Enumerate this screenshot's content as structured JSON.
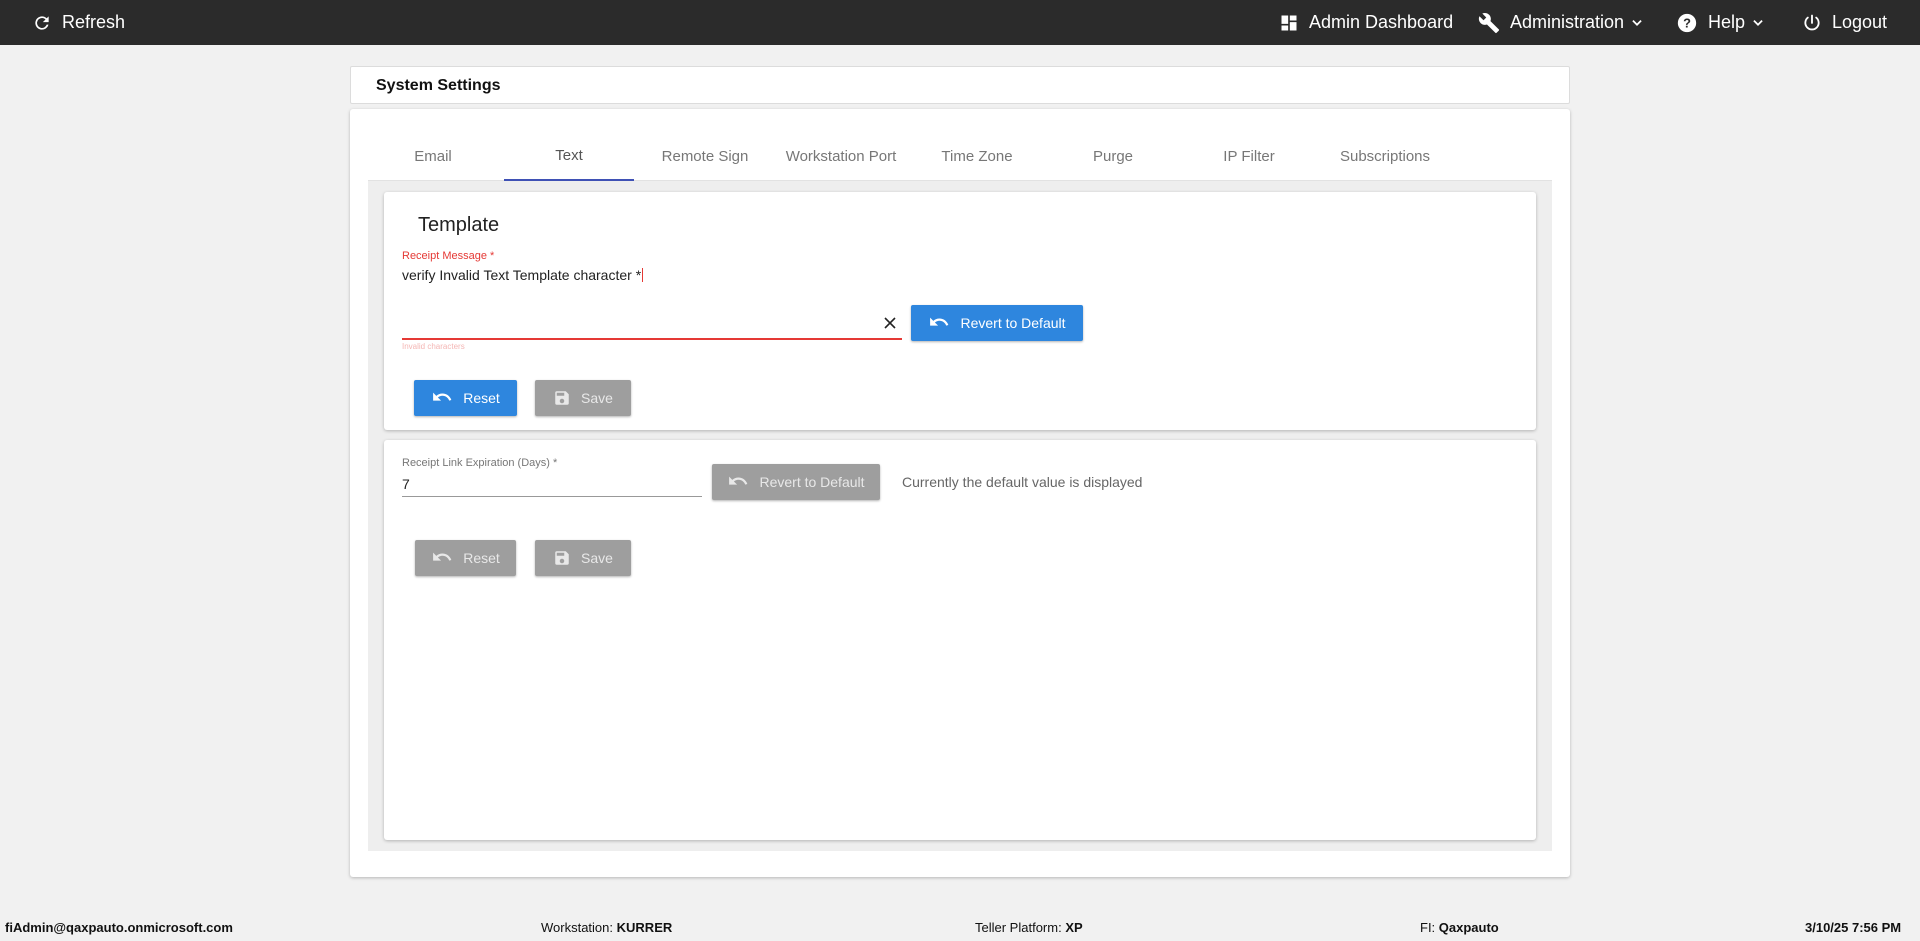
{
  "topbar": {
    "refresh_label": "Refresh",
    "admin_dashboard_label": "Admin Dashboard",
    "administration_label": "Administration",
    "help_label": "Help",
    "logout_label": "Logout"
  },
  "panel": {
    "title": "System Settings"
  },
  "tabs": [
    {
      "label": "Email"
    },
    {
      "label": "Text"
    },
    {
      "label": "Remote Sign"
    },
    {
      "label": "Workstation Port"
    },
    {
      "label": "Time Zone"
    },
    {
      "label": "Purge"
    },
    {
      "label": "IP Filter"
    },
    {
      "label": "Subscriptions"
    }
  ],
  "active_tab": "Text",
  "template_card": {
    "title": "Template",
    "receipt_message": {
      "label": "Receipt Message *",
      "value": "verify Invalid Text Template character *",
      "hint": "Invalid characters"
    },
    "revert_label": "Revert to Default",
    "reset_label": "Reset",
    "save_label": "Save"
  },
  "expiration_card": {
    "field": {
      "label": "Receipt Link Expiration (Days) *",
      "value": "7"
    },
    "revert_label": "Revert to Default",
    "info": "Currently the default value is displayed",
    "reset_label": "Reset",
    "save_label": "Save"
  },
  "footer": {
    "user": "fiAdmin@qaxpauto.onmicrosoft.com",
    "workstation_label": "Workstation:",
    "workstation_value": "KURRER",
    "teller_label": "Teller Platform:",
    "teller_value": "XP",
    "fi_label": "FI:",
    "fi_value": "Qaxpauto",
    "datetime": "3/10/25 7:56 PM"
  },
  "colors": {
    "topbar_bg": "#2b2b2b",
    "primary": "#2e86de",
    "disabled": "#9e9e9e",
    "error": "#e53935",
    "tab_indicator": "#3f51b5"
  }
}
